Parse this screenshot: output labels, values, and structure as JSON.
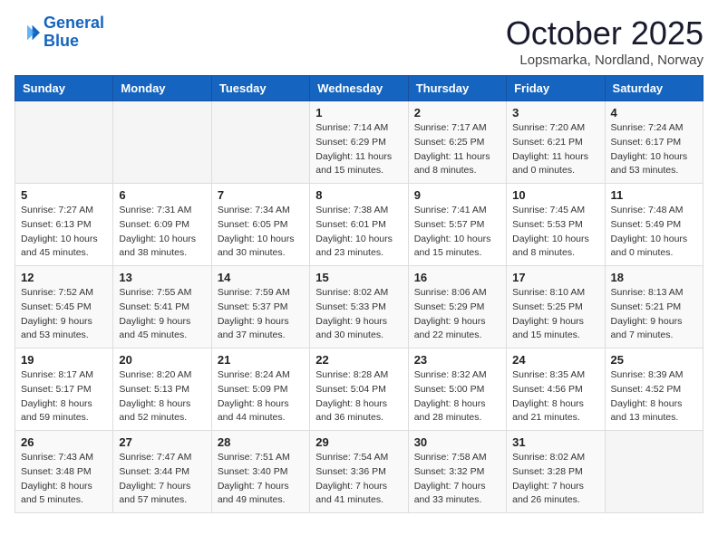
{
  "header": {
    "logo_line1": "General",
    "logo_line2": "Blue",
    "month": "October 2025",
    "location": "Lopsmarka, Nordland, Norway"
  },
  "weekdays": [
    "Sunday",
    "Monday",
    "Tuesday",
    "Wednesday",
    "Thursday",
    "Friday",
    "Saturday"
  ],
  "weeks": [
    [
      {
        "day": "",
        "info": ""
      },
      {
        "day": "",
        "info": ""
      },
      {
        "day": "",
        "info": ""
      },
      {
        "day": "1",
        "info": "Sunrise: 7:14 AM\nSunset: 6:29 PM\nDaylight: 11 hours\nand 15 minutes."
      },
      {
        "day": "2",
        "info": "Sunrise: 7:17 AM\nSunset: 6:25 PM\nDaylight: 11 hours\nand 8 minutes."
      },
      {
        "day": "3",
        "info": "Sunrise: 7:20 AM\nSunset: 6:21 PM\nDaylight: 11 hours\nand 0 minutes."
      },
      {
        "day": "4",
        "info": "Sunrise: 7:24 AM\nSunset: 6:17 PM\nDaylight: 10 hours\nand 53 minutes."
      }
    ],
    [
      {
        "day": "5",
        "info": "Sunrise: 7:27 AM\nSunset: 6:13 PM\nDaylight: 10 hours\nand 45 minutes."
      },
      {
        "day": "6",
        "info": "Sunrise: 7:31 AM\nSunset: 6:09 PM\nDaylight: 10 hours\nand 38 minutes."
      },
      {
        "day": "7",
        "info": "Sunrise: 7:34 AM\nSunset: 6:05 PM\nDaylight: 10 hours\nand 30 minutes."
      },
      {
        "day": "8",
        "info": "Sunrise: 7:38 AM\nSunset: 6:01 PM\nDaylight: 10 hours\nand 23 minutes."
      },
      {
        "day": "9",
        "info": "Sunrise: 7:41 AM\nSunset: 5:57 PM\nDaylight: 10 hours\nand 15 minutes."
      },
      {
        "day": "10",
        "info": "Sunrise: 7:45 AM\nSunset: 5:53 PM\nDaylight: 10 hours\nand 8 minutes."
      },
      {
        "day": "11",
        "info": "Sunrise: 7:48 AM\nSunset: 5:49 PM\nDaylight: 10 hours\nand 0 minutes."
      }
    ],
    [
      {
        "day": "12",
        "info": "Sunrise: 7:52 AM\nSunset: 5:45 PM\nDaylight: 9 hours\nand 53 minutes."
      },
      {
        "day": "13",
        "info": "Sunrise: 7:55 AM\nSunset: 5:41 PM\nDaylight: 9 hours\nand 45 minutes."
      },
      {
        "day": "14",
        "info": "Sunrise: 7:59 AM\nSunset: 5:37 PM\nDaylight: 9 hours\nand 37 minutes."
      },
      {
        "day": "15",
        "info": "Sunrise: 8:02 AM\nSunset: 5:33 PM\nDaylight: 9 hours\nand 30 minutes."
      },
      {
        "day": "16",
        "info": "Sunrise: 8:06 AM\nSunset: 5:29 PM\nDaylight: 9 hours\nand 22 minutes."
      },
      {
        "day": "17",
        "info": "Sunrise: 8:10 AM\nSunset: 5:25 PM\nDaylight: 9 hours\nand 15 minutes."
      },
      {
        "day": "18",
        "info": "Sunrise: 8:13 AM\nSunset: 5:21 PM\nDaylight: 9 hours\nand 7 minutes."
      }
    ],
    [
      {
        "day": "19",
        "info": "Sunrise: 8:17 AM\nSunset: 5:17 PM\nDaylight: 8 hours\nand 59 minutes."
      },
      {
        "day": "20",
        "info": "Sunrise: 8:20 AM\nSunset: 5:13 PM\nDaylight: 8 hours\nand 52 minutes."
      },
      {
        "day": "21",
        "info": "Sunrise: 8:24 AM\nSunset: 5:09 PM\nDaylight: 8 hours\nand 44 minutes."
      },
      {
        "day": "22",
        "info": "Sunrise: 8:28 AM\nSunset: 5:04 PM\nDaylight: 8 hours\nand 36 minutes."
      },
      {
        "day": "23",
        "info": "Sunrise: 8:32 AM\nSunset: 5:00 PM\nDaylight: 8 hours\nand 28 minutes."
      },
      {
        "day": "24",
        "info": "Sunrise: 8:35 AM\nSunset: 4:56 PM\nDaylight: 8 hours\nand 21 minutes."
      },
      {
        "day": "25",
        "info": "Sunrise: 8:39 AM\nSunset: 4:52 PM\nDaylight: 8 hours\nand 13 minutes."
      }
    ],
    [
      {
        "day": "26",
        "info": "Sunrise: 7:43 AM\nSunset: 3:48 PM\nDaylight: 8 hours\nand 5 minutes."
      },
      {
        "day": "27",
        "info": "Sunrise: 7:47 AM\nSunset: 3:44 PM\nDaylight: 7 hours\nand 57 minutes."
      },
      {
        "day": "28",
        "info": "Sunrise: 7:51 AM\nSunset: 3:40 PM\nDaylight: 7 hours\nand 49 minutes."
      },
      {
        "day": "29",
        "info": "Sunrise: 7:54 AM\nSunset: 3:36 PM\nDaylight: 7 hours\nand 41 minutes."
      },
      {
        "day": "30",
        "info": "Sunrise: 7:58 AM\nSunset: 3:32 PM\nDaylight: 7 hours\nand 33 minutes."
      },
      {
        "day": "31",
        "info": "Sunrise: 8:02 AM\nSunset: 3:28 PM\nDaylight: 7 hours\nand 26 minutes."
      },
      {
        "day": "",
        "info": ""
      }
    ]
  ]
}
